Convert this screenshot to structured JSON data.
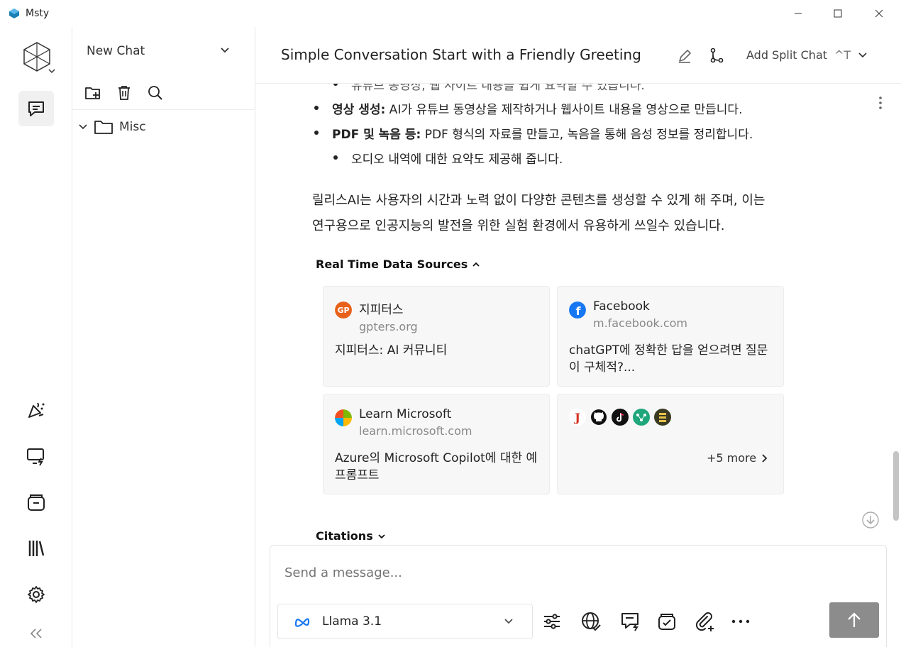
{
  "window": {
    "title": "Msty"
  },
  "sidebar": {
    "new_chat_label": "New Chat",
    "folders": [
      {
        "label": "Misc"
      }
    ]
  },
  "header": {
    "chat_title": "Simple Conversation Start with a Friendly Greeting",
    "split_chat_label": "Add Split Chat",
    "split_chat_shortcut": "^T"
  },
  "message": {
    "partial_bullet": "유튜브 동영상, 웹 사이트 내용을 쉽게 요약할 수 있습니다.",
    "bullets": [
      {
        "bold": "영상 생성:",
        "text": " AI가 유튜브 동영상을 제작하거나 웹사이트 내용을 영상으로 만듭니다."
      },
      {
        "bold": "PDF 및 녹음 등:",
        "text": " PDF 형식의 자료를 만들고, 녹음을 통해 음성 정보를 정리합니다."
      }
    ],
    "sub_bullet": "오디오 내역에 대한 요약도 제공해 줍니다.",
    "paragraph_lines": [
      "릴리스AI는 사용자의 시간과 노력 없이 다양한 콘텐츠를 생성할 수 있게 해 주며, 이는",
      "연구용으로 인공지능의 발전을 위한 실험 환경에서 유용하게 쓰일수 있습니다."
    ]
  },
  "sources": {
    "heading": "Real Time Data Sources",
    "cards": [
      {
        "title": "지피터스",
        "domain": "gpters.org",
        "snippet": "지피터스: AI 커뮤니티",
        "color": "#e8611a"
      },
      {
        "title": "Facebook",
        "domain": "m.facebook.com",
        "snippet": "chatGPT에 정확한 답을 얻으려면 질문이 구체적?...",
        "color": "#1877f2"
      },
      {
        "title": "Learn Microsoft",
        "domain": "learn.microsoft.com",
        "snippet": "Azure의 Microsoft Copilot에 대한 예 프롬프트",
        "color": "#f25022"
      }
    ],
    "more_label": "+5 more",
    "more_icon_names": [
      "j-icon",
      "github-icon",
      "tiktok-icon",
      "graph-icon",
      "stack-icon"
    ]
  },
  "citations": {
    "heading": "Citations"
  },
  "composer": {
    "placeholder": "Send a message...",
    "model_name": "Llama 3.1"
  },
  "colors": {
    "accent_blue": "#1877f2",
    "send_button": "#8c8c8c"
  }
}
